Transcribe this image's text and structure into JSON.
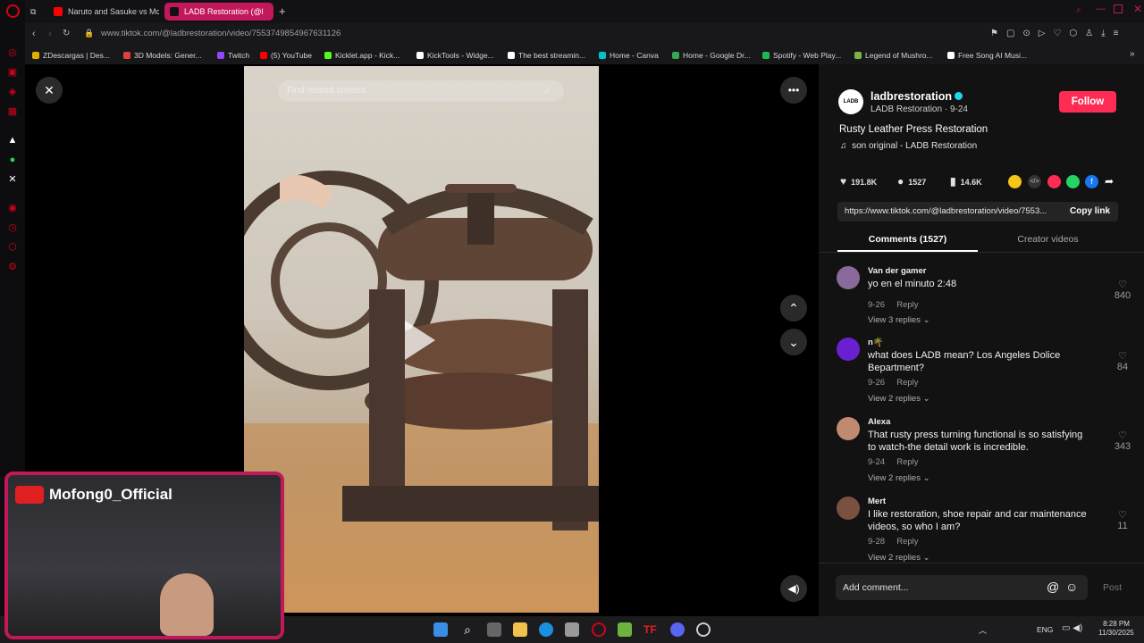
{
  "browser": {
    "tabs": [
      {
        "label": "Naruto and Sasuke vs Mc",
        "icon": "youtube-icon",
        "active": false
      },
      {
        "label": "LADB Restoration (@l",
        "icon": "tiktok-icon",
        "active": true
      }
    ],
    "url": "www.tiktok.com/@ladbrestoration/video/7553749854967631126",
    "bookmarks": [
      {
        "label": "ZDescargas | Des...",
        "color": "#e0b000"
      },
      {
        "label": "3D Models: Gener...",
        "color": "#e04040"
      },
      {
        "label": "Twitch",
        "color": "#9146ff"
      },
      {
        "label": "(5) YouTube",
        "color": "#ff0000"
      },
      {
        "label": "Kicklet.app - Kick...",
        "color": "#53fc18"
      },
      {
        "label": "KickTools - Widge...",
        "color": "#ffffff"
      },
      {
        "label": "The best streamin...",
        "color": "#ffffff"
      },
      {
        "label": "Home - Canva",
        "color": "#00c4cc"
      },
      {
        "label": "Home - Google Dr...",
        "color": "#34a853"
      },
      {
        "label": "Spotify - Web Play...",
        "color": "#1db954"
      },
      {
        "label": "Legend of Mushro...",
        "color": "#7cb342"
      },
      {
        "label": "Free Song AI Musi...",
        "color": "#ffffff"
      }
    ]
  },
  "video": {
    "search_placeholder": "Find related content"
  },
  "post": {
    "username": "ladbrestoration",
    "display_name": "LADB Restoration",
    "date": "9-24",
    "follow_label": "Follow",
    "title": "Rusty Leather Press Restoration",
    "sound": "son original - LADB Restoration",
    "likes": "191.8K",
    "comments": "1527",
    "saves": "14.6K",
    "link": "https://www.tiktok.com/@ladbrestoration/video/7553...",
    "copy_link_label": "Copy link",
    "tabs": [
      "Comments (1527)",
      "Creator videos"
    ],
    "avatar_text": "LADB"
  },
  "comments": [
    {
      "name": "Van der gamer",
      "text": "yo en el minuto 2:48",
      "date": "9-26",
      "reply": "Reply",
      "likes": "840",
      "replies": "View 3 replies",
      "avatar_color": "#8a6a9a"
    },
    {
      "name": "n🌴",
      "text": "what does LADB mean? Los Angeles Dolice Bepartment?",
      "date": "9-26",
      "reply": "Reply",
      "likes": "84",
      "replies": "View 2 replies",
      "avatar_color": "#6a1fd0"
    },
    {
      "name": "Alexa",
      "text": "That rusty press turning functional is so satisfying to watch-the detail work is incredible.",
      "date": "9-24",
      "reply": "Reply",
      "likes": "343",
      "replies": "View 2 replies",
      "avatar_color": "#c08a70"
    },
    {
      "name": "Mert",
      "text": "I like restoration, shoe repair and car maintenance videos, so who I am?",
      "date": "9-28",
      "reply": "Reply",
      "likes": "11",
      "replies": "View 2 replies",
      "avatar_color": "#7a5040"
    }
  ],
  "comment_box": {
    "placeholder": "Add comment...",
    "post_label": "Post"
  },
  "overlay": {
    "channel": "Mofong0_Official"
  },
  "taskbar": {
    "lang": "ENG",
    "time": "8:28 PM",
    "date": "11/30/2025"
  },
  "colors": {
    "accent": "#fe2c55",
    "opera_red": "#d0021b"
  }
}
